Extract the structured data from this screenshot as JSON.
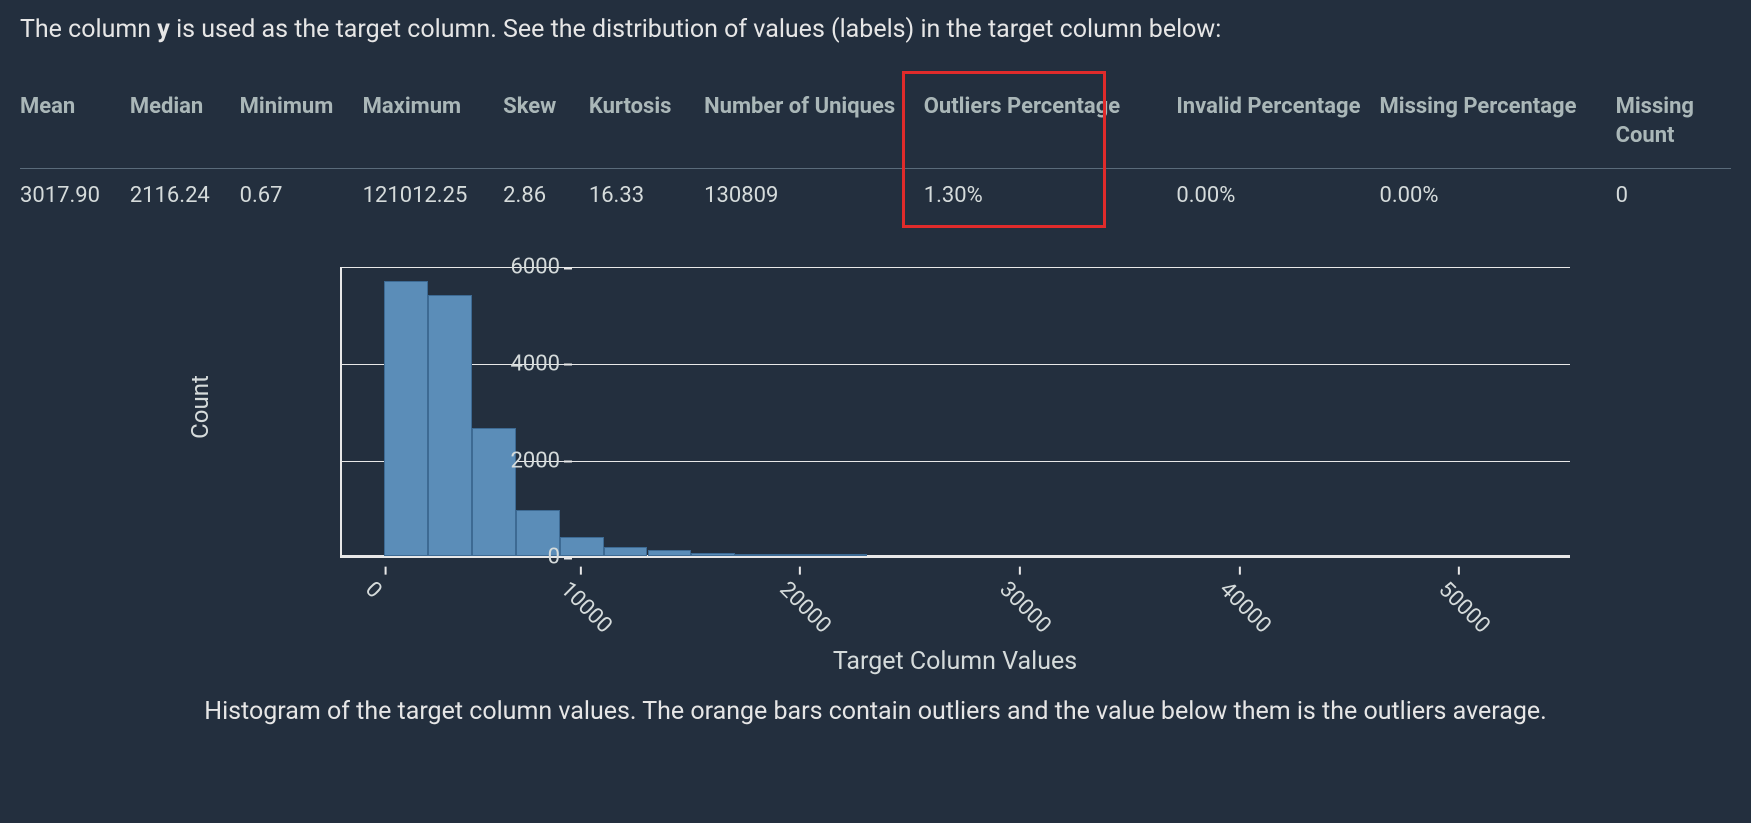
{
  "intro_prefix": "The column ",
  "intro_col": "y",
  "intro_suffix": " is used as the target column. See the distribution of values (labels) in the target column below:",
  "stats": {
    "headers": [
      "Mean",
      "Median",
      "Minimum",
      "Maximum",
      "Skew",
      "Kurtosis",
      "Number of Uniques",
      "Outliers Percentage",
      "Invalid Percentage",
      "Missing Percentage",
      "Missing Count"
    ],
    "values": [
      "3017.90",
      "2116.24",
      "0.67",
      "121012.25",
      "2.86",
      "16.33",
      "130809",
      "1.30%",
      "0.00%",
      "0.00%",
      "0"
    ],
    "highlight_index": 7
  },
  "chart_data": {
    "type": "bar",
    "xlabel": "Target Column Values",
    "ylabel": "Count",
    "ylim": [
      0,
      6000
    ],
    "yticks": [
      0,
      2000,
      4000,
      6000
    ],
    "xticks": [
      0,
      10000,
      20000,
      30000,
      40000,
      50000
    ],
    "xlim": [
      -2000,
      54000
    ],
    "bin_width": 2000,
    "series": [
      {
        "x": 0,
        "count": 5700
      },
      {
        "x": 2000,
        "count": 5400
      },
      {
        "x": 4000,
        "count": 2650
      },
      {
        "x": 6000,
        "count": 950
      },
      {
        "x": 8000,
        "count": 400
      },
      {
        "x": 10000,
        "count": 200
      },
      {
        "x": 12000,
        "count": 120
      },
      {
        "x": 14000,
        "count": 70
      },
      {
        "x": 16000,
        "count": 40
      },
      {
        "x": 18000,
        "count": 20
      },
      {
        "x": 20000,
        "count": 10
      }
    ]
  },
  "caption": "Histogram of the target column values. The orange bars contain outliers and the value below them is the outliers average."
}
